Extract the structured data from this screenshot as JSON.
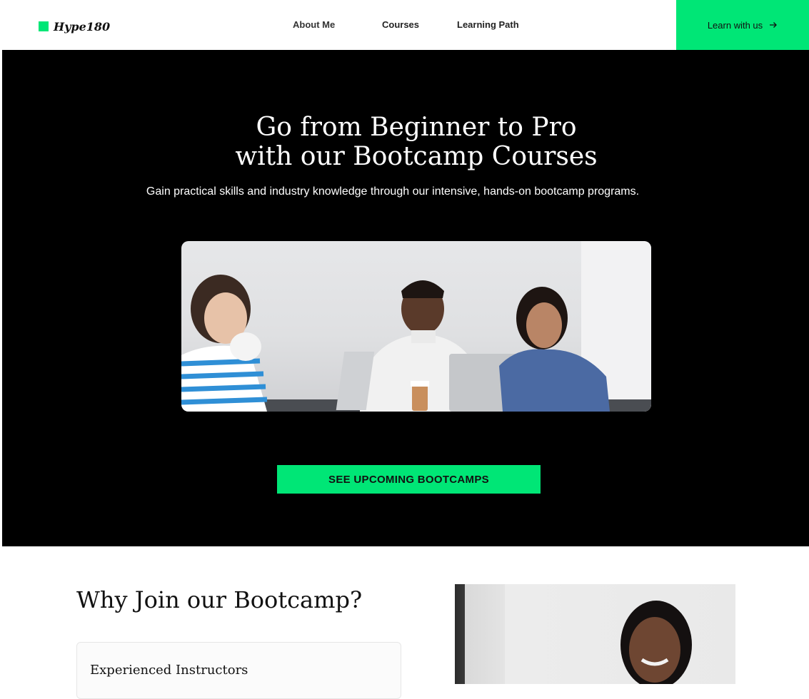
{
  "brand": {
    "name": "Hype180",
    "accent": "#00e676"
  },
  "nav": {
    "about": "About Me",
    "courses": "Courses",
    "path": "Learning Path",
    "cta": "Learn with us",
    "cta_icon": "arrow-right-icon"
  },
  "hero": {
    "title_line1": "Go from Beginner to Pro",
    "title_line2": "with our Bootcamp Courses",
    "subtitle": "Gain practical skills and industry knowledge through our intensive, hands-on bootcamp programs.",
    "cta": "SEE UPCOMING BOOTCAMPS"
  },
  "why": {
    "title": "Why Join our Bootcamp?",
    "features": [
      {
        "title": "Experienced Instructors"
      }
    ]
  },
  "colors": {
    "hero_bg": "#000000",
    "accent": "#00e676",
    "text": "#111111"
  }
}
